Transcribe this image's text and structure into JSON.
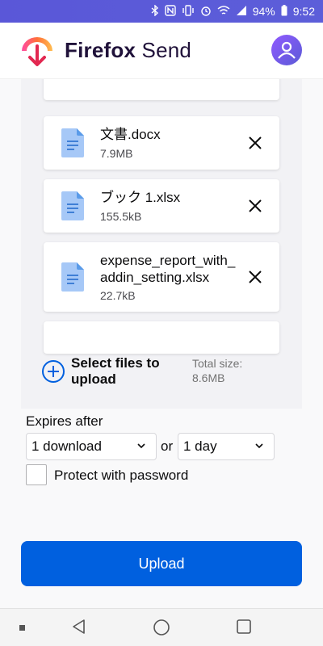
{
  "status_bar": {
    "battery": "94%",
    "time": "9:52",
    "icons": [
      "bluetooth-icon",
      "nfc-icon",
      "vibrate-icon",
      "alarm-icon",
      "wifi-icon",
      "signal-icon",
      "battery-icon"
    ]
  },
  "header": {
    "title_bold": "Firefox",
    "title_light": "Send",
    "logo_icon": "firefox-send-logo",
    "avatar_icon": "user-avatar-icon",
    "colors": {
      "title": "#20123a",
      "avatar": "#9059ff"
    }
  },
  "files": [
    {
      "name": "文書.docx",
      "size": "7.9MB"
    },
    {
      "name": "ブック 1.xlsx",
      "size": "155.5kB"
    },
    {
      "name": "expense_report_with_addin_setting.xlsx",
      "size": "22.7kB"
    }
  ],
  "upload_area": {
    "select_label": "Select files to upload",
    "total_label": "Total size:",
    "total_value": "8.6MB"
  },
  "options": {
    "expires_label": "Expires after",
    "downloads_value": "1 download",
    "or_text": "or",
    "time_value": "1 day",
    "password_label": "Protect with password"
  },
  "actions": {
    "upload_label": "Upload",
    "accent": "#0060df"
  },
  "navigation": {
    "items": [
      "square-dot-icon",
      "back-icon",
      "home-icon",
      "recents-icon"
    ]
  }
}
